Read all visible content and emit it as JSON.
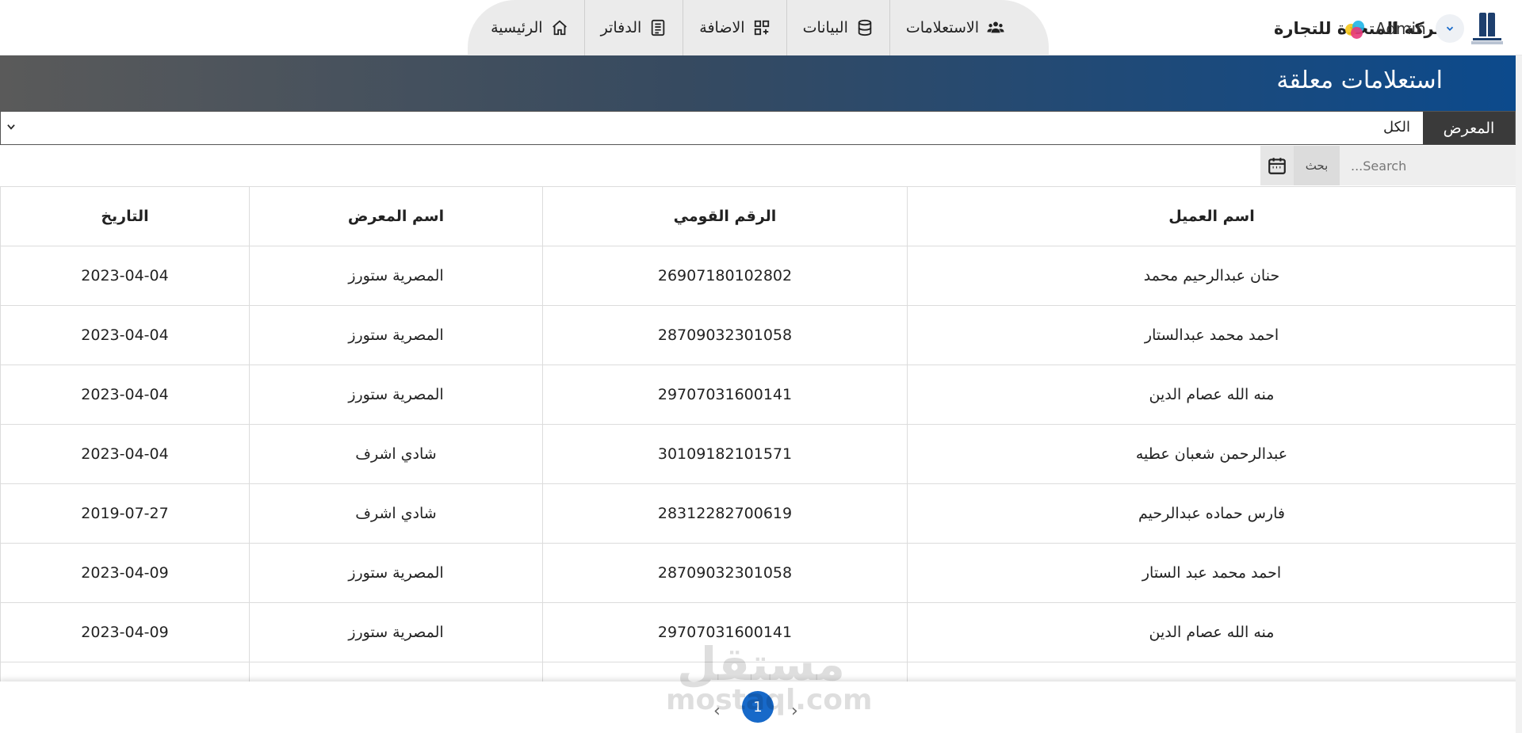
{
  "brand": {
    "name": "الشركة المتحدة للتجارة"
  },
  "nav": {
    "tabs": [
      {
        "label": "الاستعلامات",
        "icon": "users-icon"
      },
      {
        "label": "البيانات",
        "icon": "database-icon"
      },
      {
        "label": "الاضافة",
        "icon": "grid-add-icon"
      },
      {
        "label": "الدفاتر",
        "icon": "notebook-icon"
      },
      {
        "label": "الرئيسية",
        "icon": "home-icon"
      }
    ]
  },
  "user": {
    "name": "Admin",
    "menu_icon": "chevron-down-icon",
    "palette_icon": "color-palette-icon"
  },
  "page": {
    "title": "استعلامات معلقة"
  },
  "filter": {
    "label": "المعرض",
    "selected": "الكل"
  },
  "search": {
    "placeholder": "...Search",
    "button_label": "بحث",
    "calendar_icon": "calendar-icon"
  },
  "table": {
    "columns": [
      "اسم العميل",
      "الرقم القومي",
      "اسم المعرض",
      "التاريخ"
    ],
    "rows": [
      [
        "حنان عبدالرحيم محمد",
        "26907180102802",
        "المصرية ستورز",
        "2023-04-04"
      ],
      [
        "احمد محمد عبدالستار",
        "28709032301058",
        "المصرية ستورز",
        "2023-04-04"
      ],
      [
        "منه الله عصام الدين",
        "29707031600141",
        "المصرية ستورز",
        "2023-04-04"
      ],
      [
        "عبدالرحمن شعبان عطيه",
        "30109182101571",
        "شادي اشرف",
        "2023-04-04"
      ],
      [
        "فارس حماده عبدالرحيم",
        "28312282700619",
        "شادي اشرف",
        "2019-07-27"
      ],
      [
        "احمد محمد عبد الستار",
        "28709032301058",
        "المصرية ستورز",
        "2023-04-09"
      ],
      [
        "منه الله عصام الدين",
        "29707031600141",
        "المصرية ستورز",
        "2023-04-09"
      ]
    ]
  },
  "pagination": {
    "current": "1",
    "prev": "‹",
    "next": "›"
  },
  "watermark": {
    "arabic": "مستقل",
    "latin": "mostaql.com"
  },
  "colors": {
    "banner_start": "#5a5a5a",
    "banner_end": "#0c4a8c",
    "accent": "#1769c9",
    "filter_label_bg": "#3a3a3a"
  }
}
